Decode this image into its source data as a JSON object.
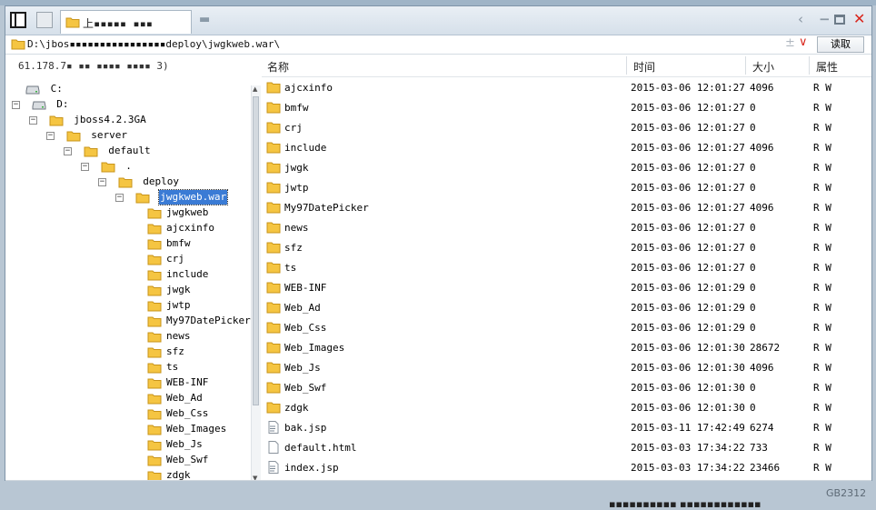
{
  "tab": {
    "title": "上▪▪▪▪▪ ▪▪▪"
  },
  "path": {
    "value": "D:\\jbos▪▪▪▪▪▪▪▪▪▪▪▪▪▪▪▪deploy\\jwgkweb.war\\",
    "read_label": "读取"
  },
  "tree": {
    "connection": "61.178.7▪ ▪▪   ▪▪▪▪ ▪▪▪▪ 3)",
    "items": [
      {
        "label": "C:"
      },
      {
        "label": "D:"
      },
      {
        "label": "jboss4.2.3GA"
      },
      {
        "label": "server"
      },
      {
        "label": "default"
      },
      {
        "label": "."
      },
      {
        "label": "deploy"
      },
      {
        "label": "jwgkweb.war"
      },
      {
        "label": "jwgkweb"
      },
      {
        "label": "ajcxinfo"
      },
      {
        "label": "bmfw"
      },
      {
        "label": "crj"
      },
      {
        "label": "include"
      },
      {
        "label": "jwgk"
      },
      {
        "label": "jwtp"
      },
      {
        "label": "My97DatePicker"
      },
      {
        "label": "news"
      },
      {
        "label": "sfz"
      },
      {
        "label": "ts"
      },
      {
        "label": "WEB-INF"
      },
      {
        "label": "Web_Ad"
      },
      {
        "label": "Web_Css"
      },
      {
        "label": "Web_Images"
      },
      {
        "label": "Web_Js"
      },
      {
        "label": "Web_Swf"
      },
      {
        "label": "zdgk"
      }
    ]
  },
  "columns": {
    "name": "名称",
    "time": "时间",
    "size": "大小",
    "attr": "属性"
  },
  "files": [
    {
      "name": "ajcxinfo",
      "time": "2015-03-06 12:01:27",
      "size": "4096",
      "attr": "R W",
      "kind": "folder"
    },
    {
      "name": "bmfw",
      "time": "2015-03-06 12:01:27",
      "size": "0",
      "attr": "R W",
      "kind": "folder"
    },
    {
      "name": "crj",
      "time": "2015-03-06 12:01:27",
      "size": "0",
      "attr": "R W",
      "kind": "folder"
    },
    {
      "name": "include",
      "time": "2015-03-06 12:01:27",
      "size": "4096",
      "attr": "R W",
      "kind": "folder"
    },
    {
      "name": "jwgk",
      "time": "2015-03-06 12:01:27",
      "size": "0",
      "attr": "R W",
      "kind": "folder"
    },
    {
      "name": "jwtp",
      "time": "2015-03-06 12:01:27",
      "size": "0",
      "attr": "R W",
      "kind": "folder"
    },
    {
      "name": "My97DatePicker",
      "time": "2015-03-06 12:01:27",
      "size": "4096",
      "attr": "R W",
      "kind": "folder"
    },
    {
      "name": "news",
      "time": "2015-03-06 12:01:27",
      "size": "0",
      "attr": "R W",
      "kind": "folder"
    },
    {
      "name": "sfz",
      "time": "2015-03-06 12:01:27",
      "size": "0",
      "attr": "R W",
      "kind": "folder"
    },
    {
      "name": "ts",
      "time": "2015-03-06 12:01:27",
      "size": "0",
      "attr": "R W",
      "kind": "folder"
    },
    {
      "name": "WEB-INF",
      "time": "2015-03-06 12:01:29",
      "size": "0",
      "attr": "R W",
      "kind": "folder"
    },
    {
      "name": "Web_Ad",
      "time": "2015-03-06 12:01:29",
      "size": "0",
      "attr": "R W",
      "kind": "folder"
    },
    {
      "name": "Web_Css",
      "time": "2015-03-06 12:01:29",
      "size": "0",
      "attr": "R W",
      "kind": "folder"
    },
    {
      "name": "Web_Images",
      "time": "2015-03-06 12:01:30",
      "size": "28672",
      "attr": "R W",
      "kind": "folder"
    },
    {
      "name": "Web_Js",
      "time": "2015-03-06 12:01:30",
      "size": "4096",
      "attr": "R W",
      "kind": "folder"
    },
    {
      "name": "Web_Swf",
      "time": "2015-03-06 12:01:30",
      "size": "0",
      "attr": "R W",
      "kind": "folder"
    },
    {
      "name": "zdgk",
      "time": "2015-03-06 12:01:30",
      "size": "0",
      "attr": "R W",
      "kind": "folder"
    },
    {
      "name": "bak.jsp",
      "time": "2015-03-11 17:42:49",
      "size": "6274",
      "attr": "R W",
      "kind": "jsp"
    },
    {
      "name": "default.html",
      "time": "2015-03-03 17:34:22",
      "size": "733",
      "attr": "R W",
      "kind": "html"
    },
    {
      "name": "index.jsp",
      "time": "2015-03-03 17:34:22",
      "size": "23466",
      "attr": "R W",
      "kind": "jsp"
    }
  ],
  "watermark": "GB2312",
  "bottom_text": "▪▪▪▪▪▪▪▪▪▪ ▪▪▪▪▪▪▪▪▪▪▪▪",
  "colors": {
    "folder": "#f5c542",
    "folder_edge": "#c8941a",
    "selected": "#3a7bd5",
    "close": "#d9261c"
  }
}
